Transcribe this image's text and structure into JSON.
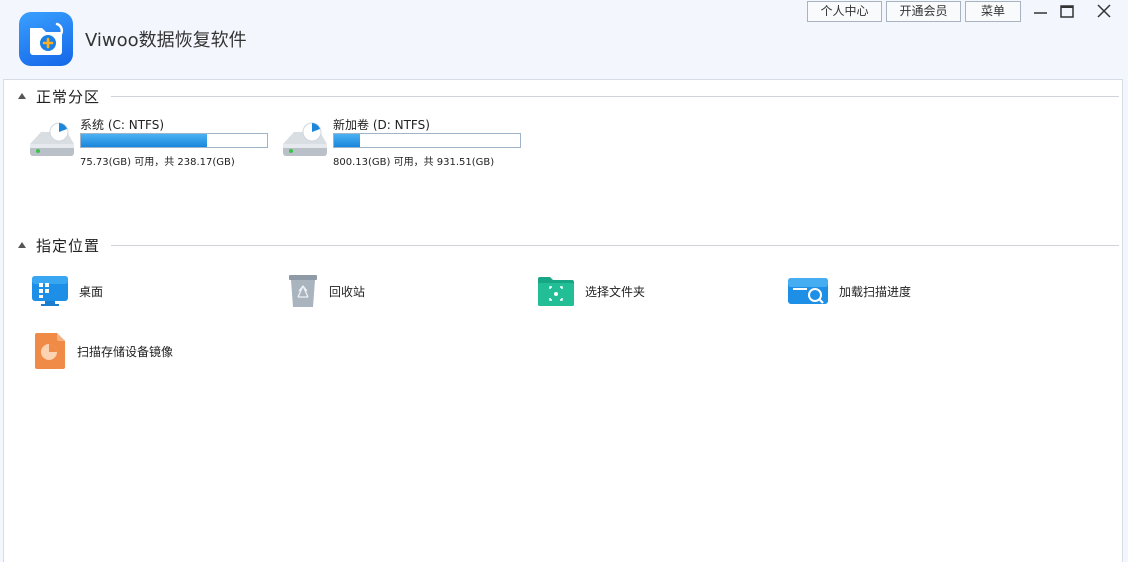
{
  "app": {
    "title": "Viwoo数据恢复软件"
  },
  "top_buttons": {
    "account": "个人中心",
    "vip": "开通会员",
    "menu": "菜单"
  },
  "sections": {
    "partitions": "正常分区",
    "locations": "指定位置"
  },
  "drives": [
    {
      "name": "系统 (C: NTFS)",
      "info": "75.73(GB) 可用，共 238.17(GB)",
      "used_fraction": 0.68
    },
    {
      "name": "新加卷 (D: NTFS)",
      "info": "800.13(GB) 可用，共 931.51(GB)",
      "used_fraction": 0.14
    }
  ],
  "locations": [
    {
      "label": "桌面",
      "icon": "desktop-icon"
    },
    {
      "label": "回收站",
      "icon": "recycle-bin-icon"
    },
    {
      "label": "选择文件夹",
      "icon": "folder-select-icon"
    },
    {
      "label": "加载扫描进度",
      "icon": "load-scan-icon"
    },
    {
      "label": "扫描存储设备镜像",
      "icon": "disk-image-icon"
    }
  ],
  "colors": {
    "accent": "#1a86dc",
    "background": "#f3f7fd"
  }
}
